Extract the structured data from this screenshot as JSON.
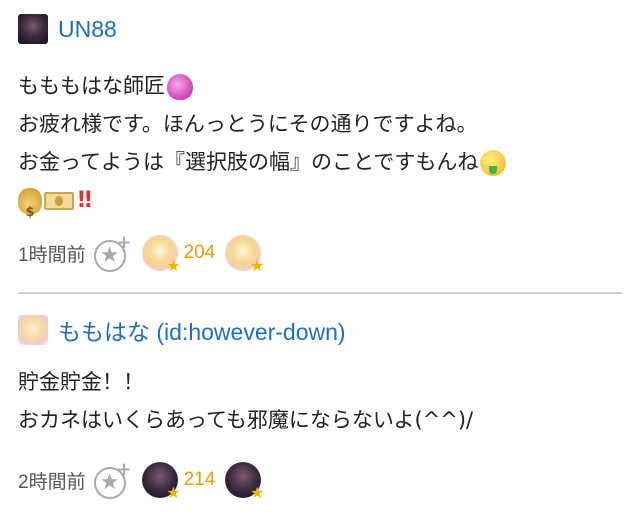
{
  "comments": [
    {
      "username": "UN88",
      "avatar_icon": "dark-portrait-avatar",
      "lines": [
        "もももはな師匠",
        "お疲れ様です。ほんっとうにその通りですよね。",
        "お金ってようは『選択肢の幅』のことですもんね"
      ],
      "emoji_line3": "money-mouth-face",
      "emoji_line4": [
        "money-bag",
        "banknote",
        "double-exclamation"
      ],
      "bangbang": "‼",
      "timestamp": "1時間前",
      "star_count": "204",
      "star_avatar_icon": "anime-girl-avatar"
    },
    {
      "username": "ももはな (id:however-down)",
      "avatar_icon": "anime-girl-avatar",
      "lines": [
        "貯金貯金！！",
        "おカネはいくらあっても邪魔にならないよ(^^)/"
      ],
      "timestamp": "2時間前",
      "star_count": "214",
      "star_avatar_icon": "dark-portrait-avatar"
    }
  ],
  "icons": {
    "add_star": "add-star-icon",
    "star_badge": "gold-star-icon"
  },
  "colors": {
    "username": "#1d6fc4",
    "body_text": "#222222",
    "timestamp": "#555555",
    "star_count": "#e6a000",
    "divider": "#cfcfcf"
  }
}
